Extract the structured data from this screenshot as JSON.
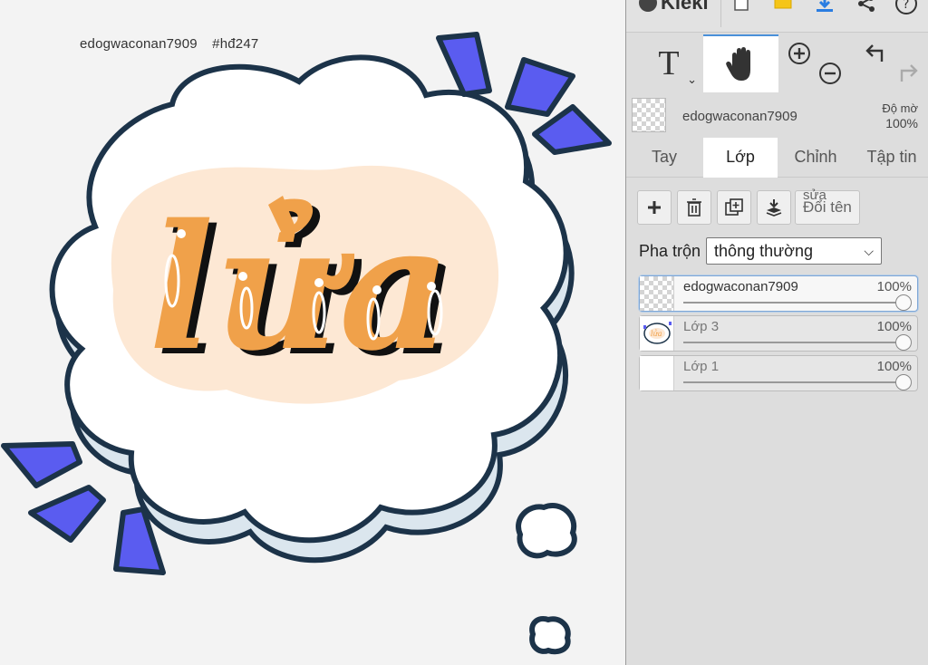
{
  "canvas": {
    "watermark_user": "edogwaconan7909",
    "watermark_tag": "#hđ247",
    "artwork_word": "lửa"
  },
  "app": {
    "logo_text": "Kleki"
  },
  "toolbar": {
    "text_tool_glyph": "T",
    "text_tool_chevron": "⌄",
    "icons": [
      "new-file-icon",
      "import-icon",
      "download-icon",
      "share-icon",
      "help-icon",
      "hand-icon",
      "zoom-in-icon",
      "zoom-out-icon",
      "undo-icon",
      "redo-icon"
    ]
  },
  "layer_info": {
    "name": "edogwaconan7909",
    "opacity_label": "Độ mờ",
    "opacity_value": "100%"
  },
  "tabs": [
    {
      "label": "Tay",
      "active": false
    },
    {
      "label": "Lớp",
      "active": true
    },
    {
      "label": "Chỉnh",
      "active": false
    },
    {
      "label": "Tập tin",
      "active": false
    }
  ],
  "layer_buttons": {
    "rename_small": "sửa",
    "rename_main": "Đổi tên"
  },
  "blend": {
    "label": "Pha trộn",
    "value": "thông thường"
  },
  "layers": [
    {
      "name": "edogwaconan7909",
      "opacity": "100%",
      "selected": true
    },
    {
      "name": "Lớp 3",
      "opacity": "100%",
      "selected": false
    },
    {
      "name": "Lớp 1",
      "opacity": "100%",
      "selected": false
    }
  ],
  "colors": {
    "accent": "#4a90d9",
    "cloud_outline": "#1c3349",
    "burst_blue": "#5a5cf0",
    "letter_orange": "#f0a14a",
    "blob_peach": "#fde8d4"
  }
}
